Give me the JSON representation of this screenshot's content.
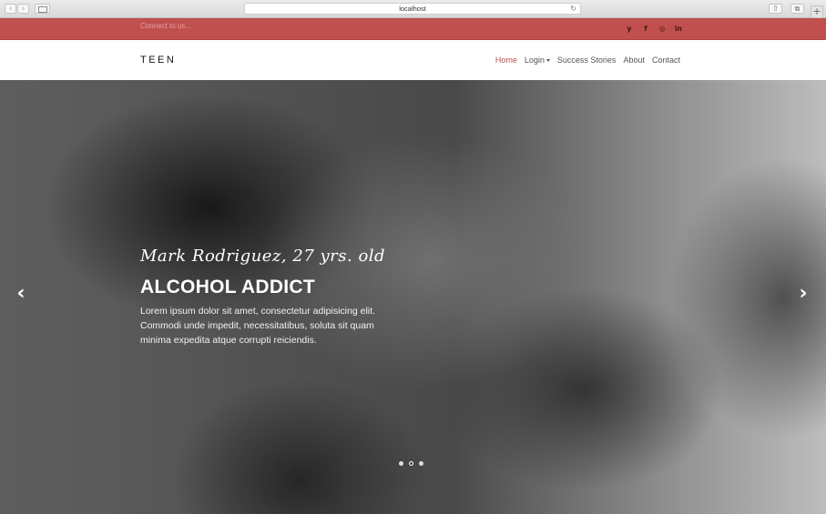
{
  "browser": {
    "url": "localhost",
    "back_glyph": "‹",
    "forward_glyph": "›",
    "reload_glyph": "↻",
    "share_glyph": "⇧",
    "tabs_glyph": "⧉",
    "newtab_glyph": "+"
  },
  "topbar": {
    "connect_text": "Connect to us...",
    "socials": [
      {
        "icon": "twitter-icon",
        "glyph": "y"
      },
      {
        "icon": "facebook-icon",
        "glyph": "f"
      },
      {
        "icon": "instagram-icon",
        "glyph": "◎"
      },
      {
        "icon": "linkedin-icon",
        "glyph": "in"
      }
    ],
    "bar_color": "#c0504e"
  },
  "navbar": {
    "brand": "TEEN",
    "items": [
      {
        "label": "Home",
        "active": true
      },
      {
        "label": "Login",
        "dropdown": true
      },
      {
        "label": "Success Stories"
      },
      {
        "label": "About"
      },
      {
        "label": "Contact"
      }
    ],
    "accent_color": "#c0504e"
  },
  "hero": {
    "subtitle": "Mark Rodriguez, 27 yrs. old",
    "title": "ALCOHOL ADDICT",
    "description": "Lorem ipsum dolor sit amet, consectetur adipisicing elit. Commodi unde impedit, necessitatibus, soluta sit quam minima expedita atque corrupti reiciendis.",
    "prev_glyph": "‹",
    "next_glyph": "›",
    "slides": 3,
    "active_slide": 2
  }
}
